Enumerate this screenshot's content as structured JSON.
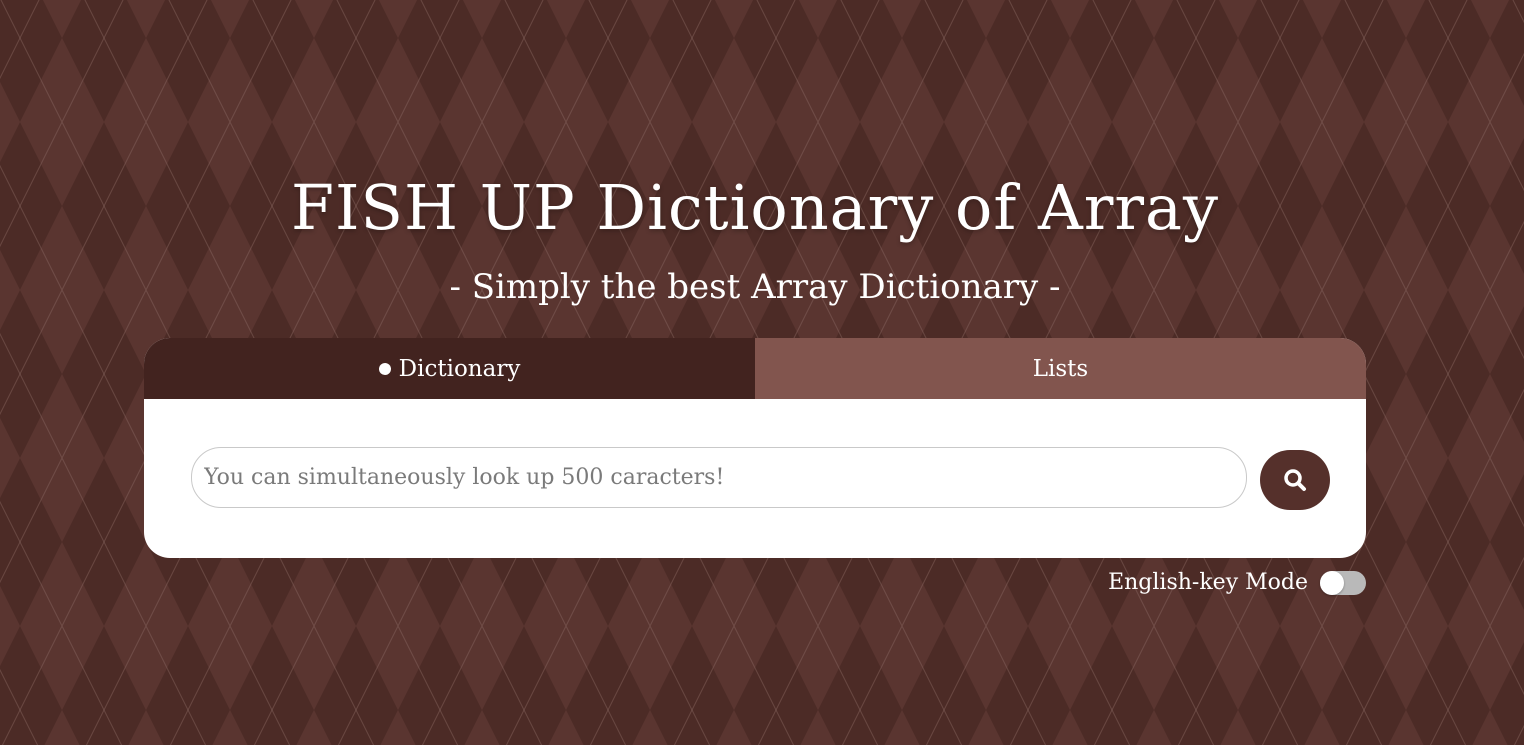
{
  "header": {
    "title": "FISH UP Dictionary of Array",
    "subtitle": "- Simply the best Array Dictionary -"
  },
  "tabs": [
    {
      "label": "Dictionary",
      "active": true
    },
    {
      "label": "Lists",
      "active": false
    }
  ],
  "search": {
    "placeholder": "You can simultaneously look up 500 caracters!",
    "value": "",
    "button_icon": "search-icon"
  },
  "mode": {
    "label": "English-key Mode",
    "enabled": false
  },
  "colors": {
    "background": "#55322c",
    "tab_active": "#42231f",
    "tab_inactive": "#82554e",
    "search_button": "#55302b",
    "toggle_off": "#b9b9b9"
  }
}
